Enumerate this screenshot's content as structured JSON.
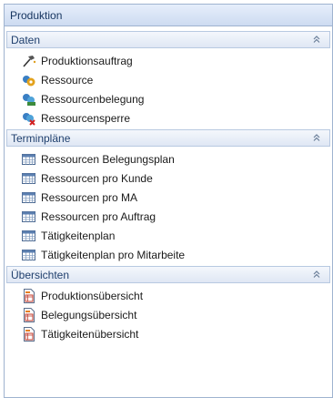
{
  "panel": {
    "title": "Produktion"
  },
  "groups": [
    {
      "title": "Daten",
      "items": [
        {
          "label": "Produktionsauftrag",
          "icon": "hammer-icon"
        },
        {
          "label": "Ressource",
          "icon": "resource-icon"
        },
        {
          "label": "Ressourcenbelegung",
          "icon": "resource-allocation-icon"
        },
        {
          "label": "Ressourcensperre",
          "icon": "resource-block-icon"
        }
      ]
    },
    {
      "title": "Terminpläne",
      "items": [
        {
          "label": "Ressourcen Belegungsplan",
          "icon": "calendar-table-icon"
        },
        {
          "label": "Ressourcen pro Kunde",
          "icon": "calendar-table-icon"
        },
        {
          "label": "Ressourcen pro MA",
          "icon": "calendar-table-icon"
        },
        {
          "label": "Ressourcen pro Auftrag",
          "icon": "calendar-table-icon"
        },
        {
          "label": "Tätigkeitenplan",
          "icon": "calendar-table-icon"
        },
        {
          "label": "Tätigkeitenplan pro Mitarbeite",
          "icon": "calendar-table-icon"
        }
      ]
    },
    {
      "title": "Übersichten",
      "items": [
        {
          "label": "Produktionsübersicht",
          "icon": "report-document-icon"
        },
        {
          "label": "Belegungsübersicht",
          "icon": "report-document-icon"
        },
        {
          "label": "Tätigkeitenübersicht",
          "icon": "report-document-icon"
        }
      ]
    }
  ]
}
